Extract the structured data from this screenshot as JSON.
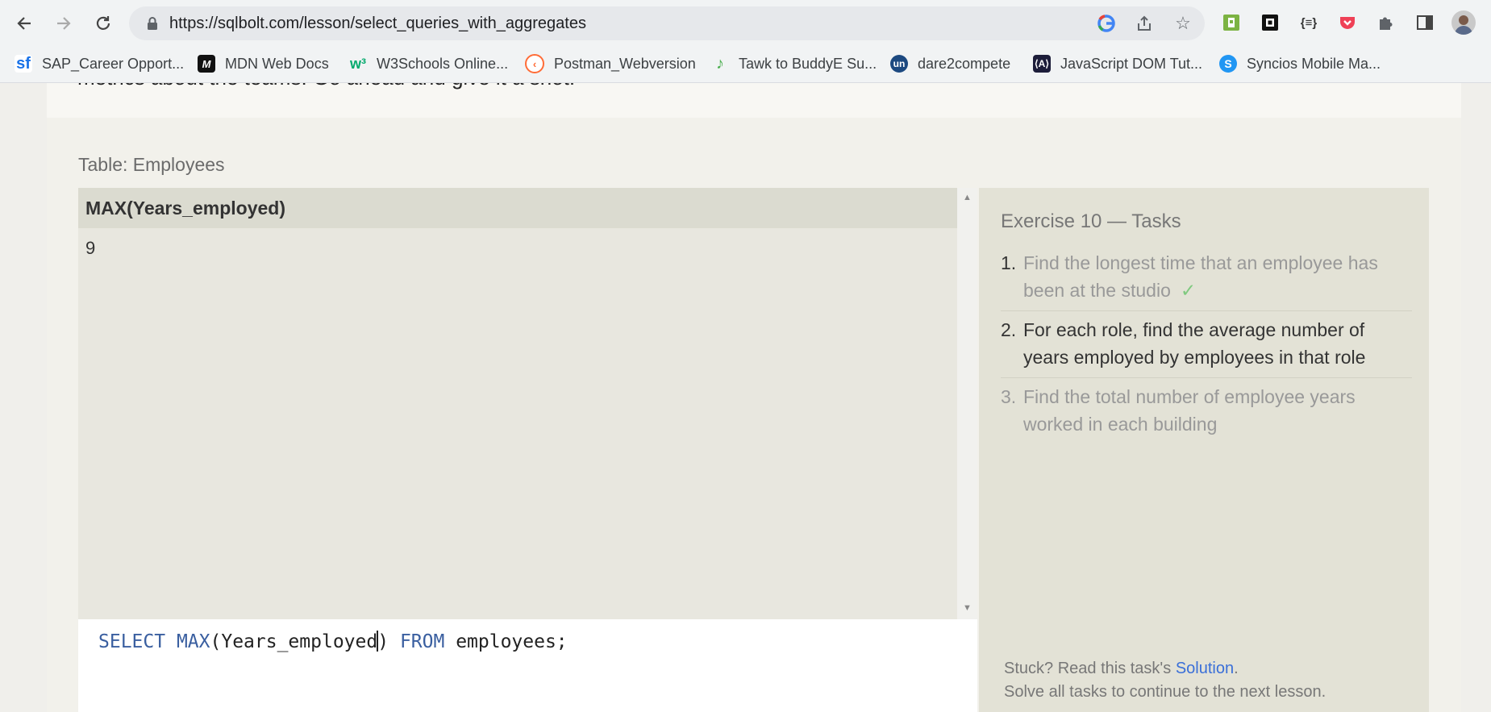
{
  "browser": {
    "url": "https://sqlbolt.com/lesson/select_queries_with_aggregates",
    "bookmarks": [
      {
        "label": "SAP_Career Opport...",
        "icon": "sf-logo"
      },
      {
        "label": "MDN Web Docs",
        "icon": "mdn-logo"
      },
      {
        "label": "W3Schools Online...",
        "icon": "w3schools-logo"
      },
      {
        "label": "Postman_Webversion",
        "icon": "postman-logo"
      },
      {
        "label": "Tawk to BuddyE Su...",
        "icon": "tawk-logo"
      },
      {
        "label": "dare2compete",
        "icon": "unstop-logo"
      },
      {
        "label": "JavaScript DOM Tut...",
        "icon": "js-dom-logo"
      },
      {
        "label": "Syncios Mobile Ma...",
        "icon": "syncios-logo"
      }
    ]
  },
  "lesson": {
    "intro_fragment": "metrics about the teams. Go ahead and give it a shot.",
    "table_caption": "Table: Employees",
    "result": {
      "column": "MAX(Years_employed)",
      "value": "9"
    },
    "query": {
      "kw_select": "SELECT",
      "kw_max": "MAX",
      "arg_before_caret": "(Years_employed",
      "arg_after_caret": ")",
      "kw_from": "FROM",
      "table_name": "employees;"
    }
  },
  "exercise": {
    "title": "Exercise 10 — Tasks",
    "tasks": [
      {
        "num": "1.",
        "text": "Find the longest time that an employee has been at the studio",
        "check": "✓"
      },
      {
        "num": "2.",
        "text": "For each role, find the average number of years employed by employees in that role"
      },
      {
        "num": "3.",
        "text": "Find the total number of employee years worked in each building"
      }
    ],
    "stuck_prefix": "Stuck? Read this task's ",
    "solution_link": "Solution",
    "stuck_suffix": ".",
    "continue_note": "Solve all tasks to continue to the next lesson."
  },
  "colors": {
    "keyword": "#3a5fa0",
    "link": "#3a6fd8",
    "check": "#7fc97f"
  }
}
